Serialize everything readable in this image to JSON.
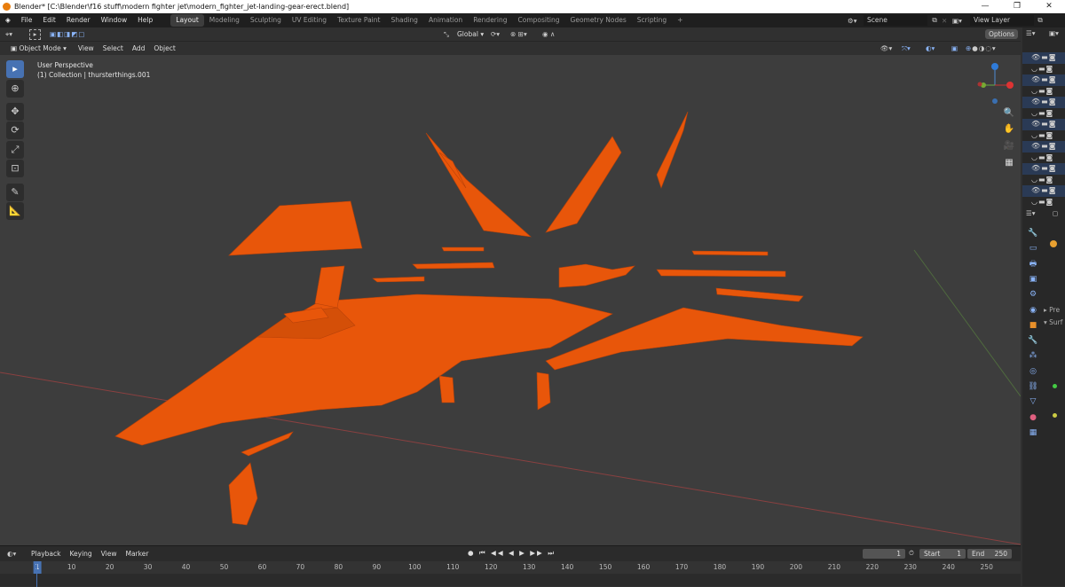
{
  "window": {
    "title": "Blender* [C:\\Blender\\f16 stuff\\modern fighter jet\\modern_fighter_jet-landing-gear-erect.blend]",
    "controls": [
      "—",
      "❐",
      "✕"
    ]
  },
  "menus": [
    "File",
    "Edit",
    "Render",
    "Window",
    "Help"
  ],
  "workspaces": [
    {
      "label": "Layout",
      "active": true
    },
    {
      "label": "Modeling"
    },
    {
      "label": "Sculpting"
    },
    {
      "label": "UV Editing"
    },
    {
      "label": "Texture Paint"
    },
    {
      "label": "Shading"
    },
    {
      "label": "Animation"
    },
    {
      "label": "Rendering"
    },
    {
      "label": "Compositing"
    },
    {
      "label": "Geometry Nodes"
    },
    {
      "label": "Scripting"
    },
    {
      "label": "+"
    }
  ],
  "scene": {
    "name": "Scene",
    "view_layer": "View Layer"
  },
  "tool_header": {
    "transform_orientation": "Global",
    "options": "Options"
  },
  "viewport_header": {
    "mode": "Object Mode",
    "menus": [
      "View",
      "Select",
      "Add",
      "Object"
    ]
  },
  "viewport": {
    "perspective": "User Perspective",
    "collection_info": "(1) Collection | thursterthings.001",
    "object_color": "#e8560a",
    "bg_color": "#3d3d3d"
  },
  "tools": [
    "select-box",
    "cursor",
    "move",
    "rotate",
    "scale",
    "transform",
    "annotate",
    "measure"
  ],
  "outliner_rows": [
    true,
    false,
    true,
    false,
    true,
    false,
    true,
    false,
    true,
    false,
    true,
    false,
    true,
    false
  ],
  "properties": {
    "pre_label": "Pre",
    "surf_label": "Surf"
  },
  "timeline": {
    "menus": [
      "Playback",
      "Keying",
      "View",
      "Marker"
    ],
    "current_frame": "1",
    "start_label": "Start",
    "start": "1",
    "end_label": "End",
    "end": "250",
    "ticks": [
      1,
      10,
      20,
      30,
      40,
      50,
      60,
      70,
      80,
      90,
      100,
      110,
      120,
      130,
      140,
      150,
      160,
      170,
      180,
      190,
      200,
      210,
      220,
      230,
      240,
      250
    ]
  }
}
